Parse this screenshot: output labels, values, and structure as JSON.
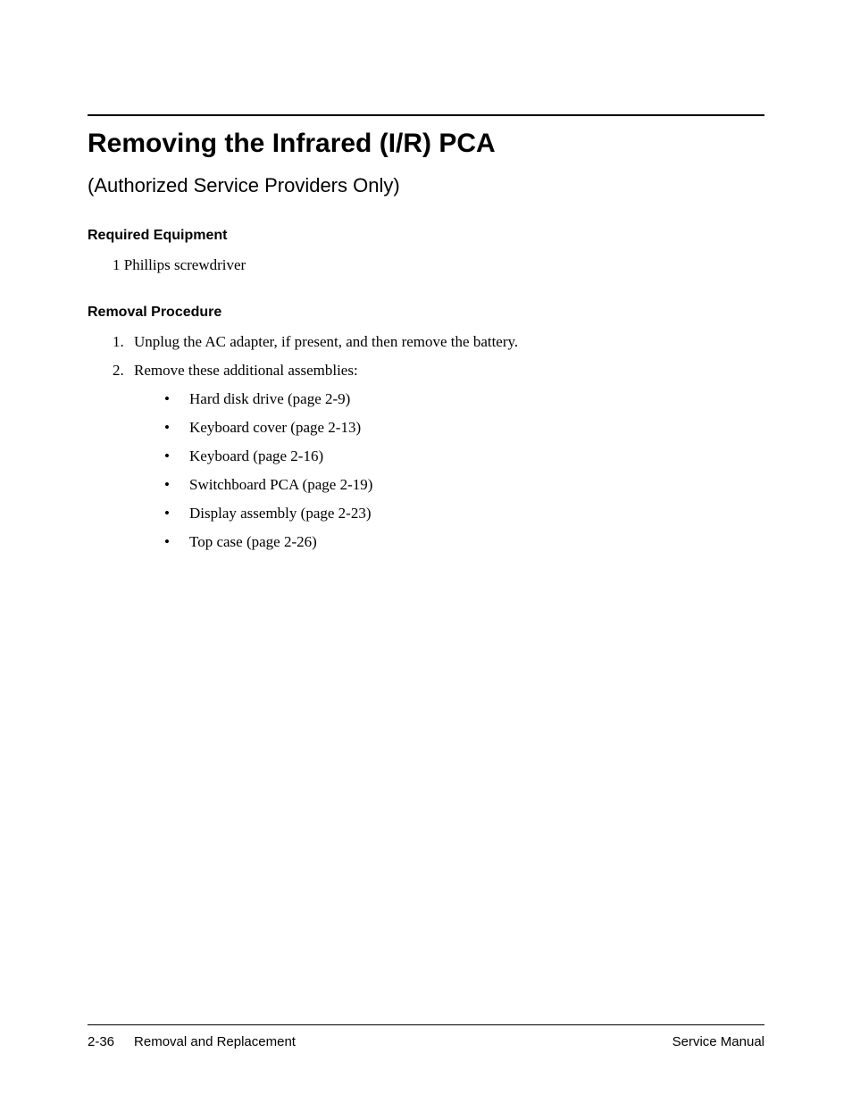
{
  "title": "Removing the Infrared (I/R) PCA",
  "subtitle": "(Authorized Service Providers Only)",
  "sections": {
    "equipment_heading": "Required Equipment",
    "equipment_item": "1 Phillips screwdriver",
    "procedure_heading": "Removal Procedure"
  },
  "steps": [
    {
      "num": "1",
      "text": "Unplug the AC adapter, if present, and then remove the battery."
    },
    {
      "num": "2",
      "text": "Remove these additional assemblies:"
    }
  ],
  "subitems": [
    "Hard disk drive (page 2-9)",
    "Keyboard cover (page 2-13)",
    "Keyboard (page 2-16)",
    "Switchboard PCA (page 2-19)",
    "Display assembly (page 2-23)",
    "Top case (page 2-26)"
  ],
  "footer": {
    "page_num": "2-36",
    "section": "Removal and Replacement",
    "doc": "Service Manual"
  }
}
